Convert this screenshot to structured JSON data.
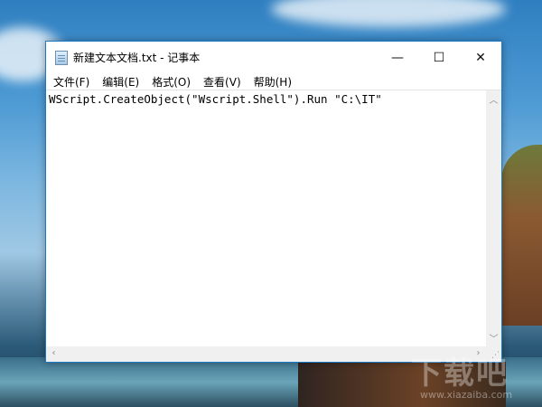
{
  "window": {
    "title": "新建文本文档.txt - 记事本",
    "controls": {
      "minimize": "—",
      "maximize": "☐",
      "close": "✕"
    }
  },
  "menu": [
    {
      "label": "文件(F)"
    },
    {
      "label": "编辑(E)"
    },
    {
      "label": "格式(O)"
    },
    {
      "label": "查看(V)"
    },
    {
      "label": "帮助(H)"
    }
  ],
  "editor": {
    "content": "WScript.CreateObject(\"Wscript.Shell\").Run \"C:\\IT\""
  },
  "scrollbars": {
    "up": "︿",
    "down": "﹀",
    "left": "‹",
    "right": "›"
  },
  "watermark": {
    "logo": "下载吧",
    "url": "www.xiazaiba.com"
  }
}
